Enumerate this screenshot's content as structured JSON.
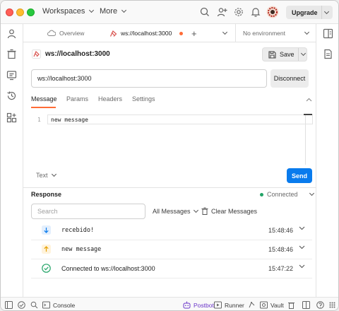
{
  "titlebar": {
    "menu_workspaces": "Workspaces",
    "menu_more": "More",
    "upgrade_label": "Upgrade"
  },
  "tabs": {
    "overview_label": "Overview",
    "active_label": "ws://localhost:3000",
    "new_tab": "+",
    "environment": "No environment"
  },
  "request": {
    "title": "ws://localhost:3000",
    "save_label": "Save",
    "url_value": "ws://localhost:3000",
    "disconnect_label": "Disconnect"
  },
  "subtabs": [
    "Message",
    "Params",
    "Headers",
    "Settings"
  ],
  "editor": {
    "line_number": "1",
    "content": "new message",
    "format": "Text",
    "send_label": "Send"
  },
  "response": {
    "title": "Response",
    "status": "Connected",
    "search_placeholder": "Search",
    "filter_label": "All Messages",
    "clear_label": "Clear Messages",
    "messages": [
      {
        "direction": "incoming",
        "text": "recebido!",
        "time": "15:48:46"
      },
      {
        "direction": "outgoing",
        "text": "new message",
        "time": "15:48:46"
      },
      {
        "direction": "connected",
        "text": "Connected to ws://localhost:3000",
        "time": "15:47:22"
      }
    ]
  },
  "statusbar": {
    "console": "Console",
    "postbot": "Postbot",
    "runner": "Runner",
    "vault": "Vault"
  },
  "colors": {
    "accent": "#ff6c37",
    "primary": "#097bed",
    "connected": "#21a366",
    "postbot": "#6b35c9"
  }
}
